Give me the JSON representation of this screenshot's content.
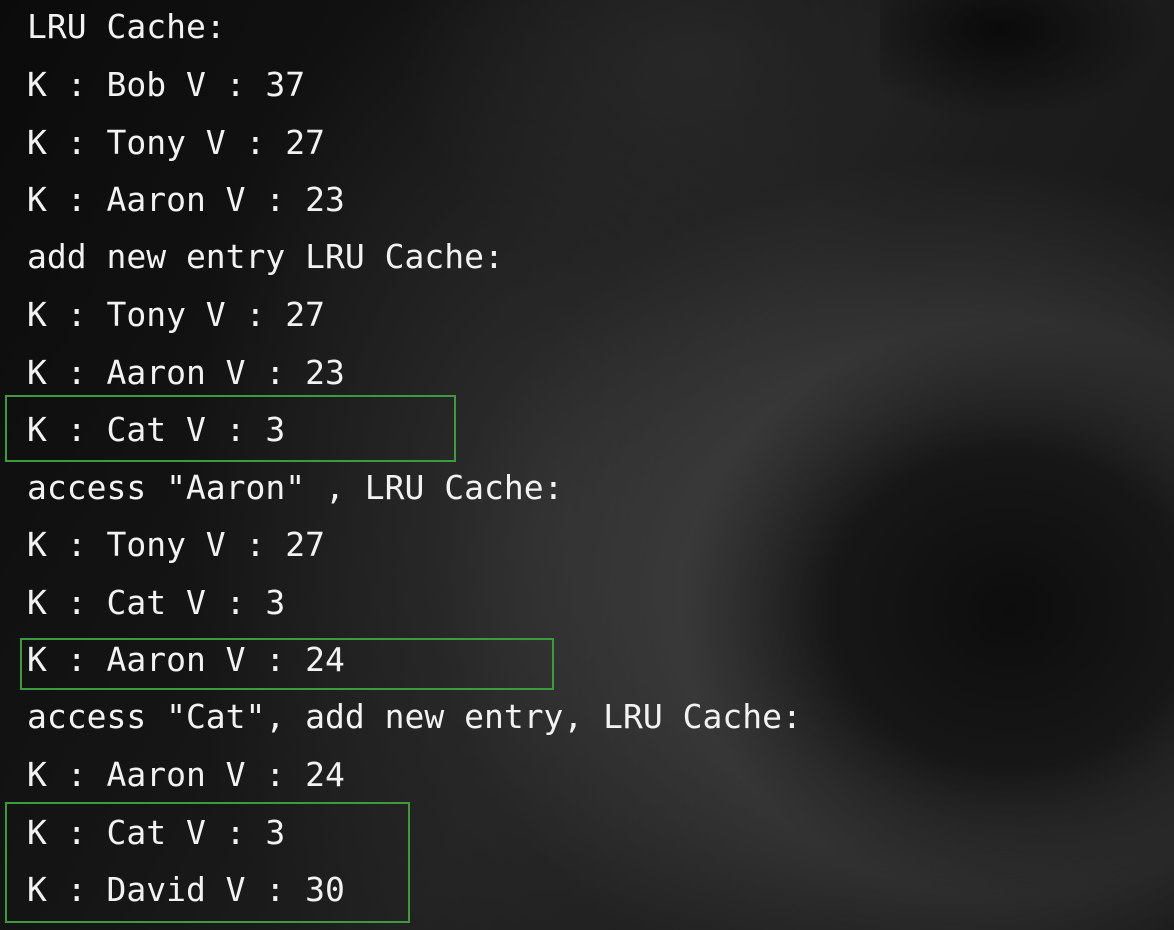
{
  "console": {
    "lines": [
      "LRU Cache:",
      "K : Bob V : 37",
      "K : Tony V : 27",
      "K : Aaron V : 23",
      "add new entry LRU Cache:",
      "K : Tony V : 27",
      "K : Aaron V : 23",
      "K : Cat V : 3",
      "access \"Aaron\" , LRU Cache:",
      "K : Tony V : 27",
      "K : Cat V : 3",
      "K : Aaron V : 24",
      "access \"Cat\", add new entry, LRU Cache:",
      "K : Aaron V : 24",
      "K : Cat V : 3",
      "K : David V : 30"
    ],
    "highlight_color": "#3f9a3f",
    "text_color": "#f2f2f2"
  }
}
